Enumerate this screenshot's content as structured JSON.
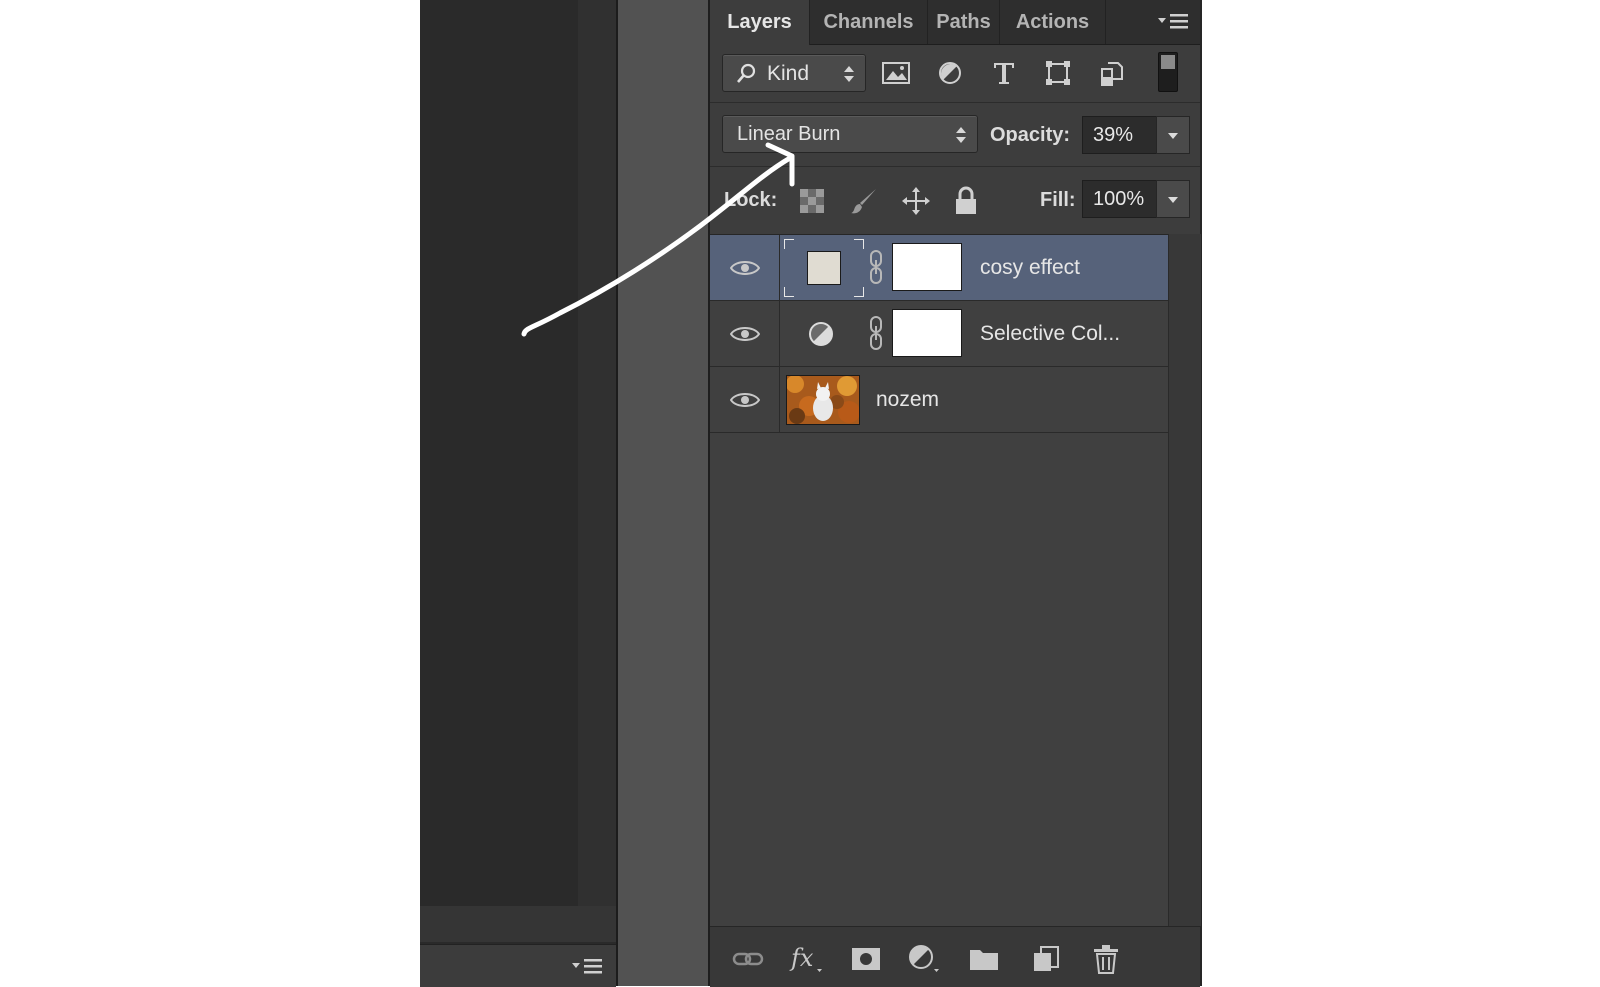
{
  "tabs": [
    {
      "label": "Layers",
      "active": true
    },
    {
      "label": "Channels",
      "active": false
    },
    {
      "label": "Paths",
      "active": false
    },
    {
      "label": "Actions",
      "active": false
    }
  ],
  "filter": {
    "kind_label": "Kind",
    "icons": [
      "image-filter-icon",
      "adjustment-filter-icon",
      "type-filter-icon",
      "shape-filter-icon",
      "smart-object-filter-icon"
    ]
  },
  "blend": {
    "mode": "Linear Burn",
    "opacity_label": "Opacity:",
    "opacity_value": "39%"
  },
  "lock": {
    "label": "Lock:",
    "icons": [
      "lock-transparent-icon",
      "lock-image-icon",
      "lock-position-icon",
      "lock-all-icon"
    ],
    "fill_label": "Fill:",
    "fill_value": "100%"
  },
  "layers": [
    {
      "name": "cosy effect",
      "selected": true,
      "visible": true,
      "type": "fill",
      "swatch": "#e0dcd2"
    },
    {
      "name": "Selective Col...",
      "selected": false,
      "visible": true,
      "type": "adjustment"
    },
    {
      "name": "nozem",
      "selected": false,
      "visible": true,
      "type": "image"
    }
  ],
  "bottom_icons": [
    "link-layers-icon",
    "fx-icon",
    "add-mask-icon",
    "new-adjustment-icon",
    "new-group-icon",
    "new-layer-icon",
    "delete-layer-icon"
  ],
  "colors": {
    "selected_row": "#56627a",
    "panel_bg": "#3d3d3d",
    "workspace": "#2a2a2a"
  }
}
